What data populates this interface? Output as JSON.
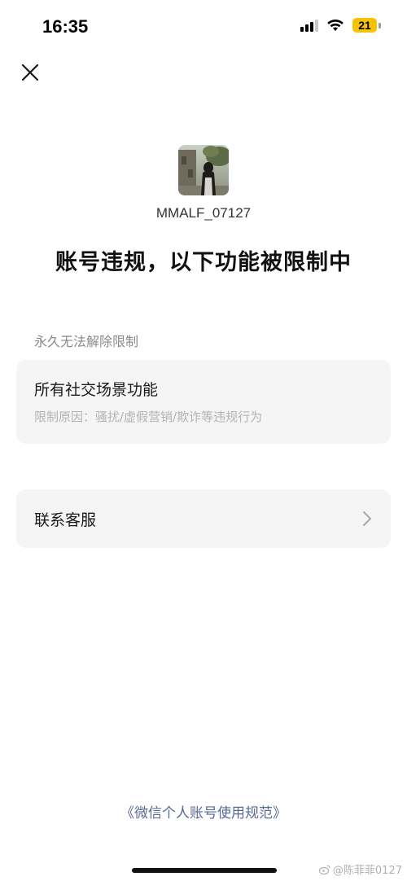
{
  "status_bar": {
    "time": "16:35",
    "battery": "21"
  },
  "header": {
    "close_icon": "close-icon"
  },
  "profile": {
    "username": "MMALF_07127"
  },
  "title": "账号违规，以下功能被限制中",
  "restriction_section": {
    "label": "永久无法解除限制",
    "item_title": "所有社交场景功能",
    "item_reason": "限制原因：骚扰/虚假营销/欺诈等违规行为"
  },
  "service": {
    "label": "联系客服",
    "icon": "chevron-right-icon"
  },
  "footer": {
    "policy_link": "《微信个人账号使用规范》",
    "watermark": "@陈菲菲0127"
  },
  "colors": {
    "link": "#576b95",
    "card_bg": "#f5f5f5",
    "battery": "#f5c400"
  }
}
